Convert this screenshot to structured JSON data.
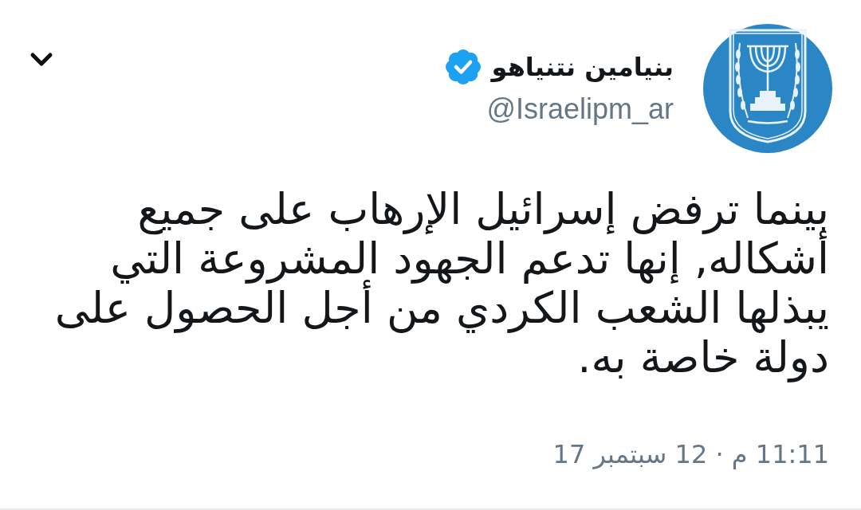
{
  "tweet": {
    "author": {
      "name": "بنيامين نتنياهو",
      "verified": true,
      "handle": "@Israelipm_ar"
    },
    "text": "بينما ترفض إسرائيل الإرهاب على جميع أشكاله, إنها تدعم الجهود المشروعة التي يبذلها الشعب الكردي من أجل الحصول على دولة خاصة به.",
    "timestamp": "11:11 م · 12 سبتمبر 17"
  }
}
